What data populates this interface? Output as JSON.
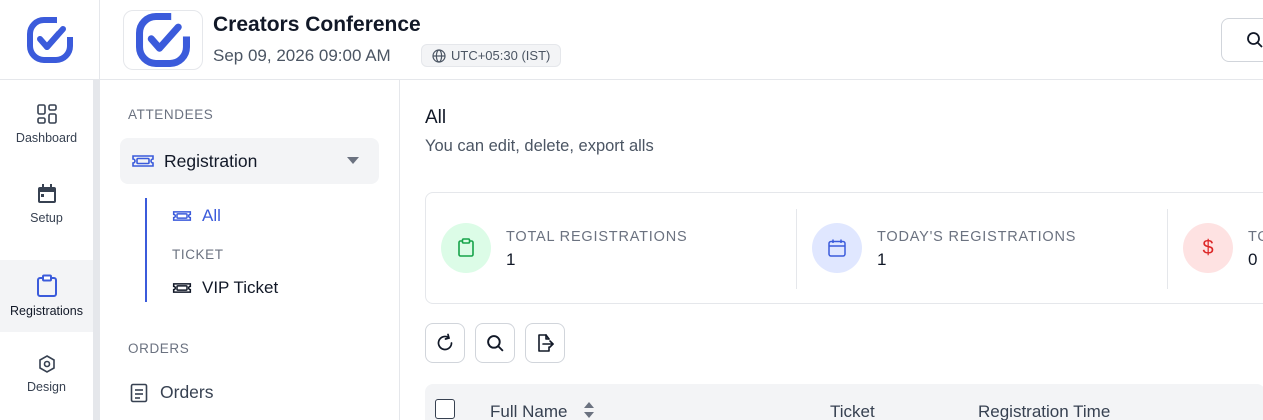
{
  "rail": {
    "items": [
      {
        "label": "Dashboard",
        "icon": "dashboard-icon"
      },
      {
        "label": "Setup",
        "icon": "calendar-icon"
      },
      {
        "label": "Registrations",
        "icon": "clipboard-icon"
      },
      {
        "label": "Design",
        "icon": "design-icon"
      }
    ],
    "active": "Registrations"
  },
  "header": {
    "title": "Creators Conference",
    "date": "Sep 09, 2026 09:00 AM",
    "timezone": "UTC+05:30 (IST)"
  },
  "subnav": {
    "attendees_label": "ATTENDEES",
    "registration_label": "Registration",
    "all_label": "All",
    "ticket_label": "TICKET",
    "vip_label": "VIP Ticket",
    "orders_section": "ORDERS",
    "orders_label": "Orders"
  },
  "main": {
    "title": "All",
    "subtitle": "You can edit, delete, export alls",
    "stats": [
      {
        "label": "TOTAL REGISTRATIONS",
        "value": "1"
      },
      {
        "label": "TODAY'S REGISTRATIONS",
        "value": "1"
      },
      {
        "label": "TO",
        "value": "0"
      }
    ],
    "table_headers": {
      "full_name": "Full Name",
      "ticket": "Ticket",
      "registration_time": "Registration Time"
    }
  },
  "colors": {
    "brand": "#3b5bdb",
    "green": "#16a34a",
    "red": "#dc2626"
  }
}
